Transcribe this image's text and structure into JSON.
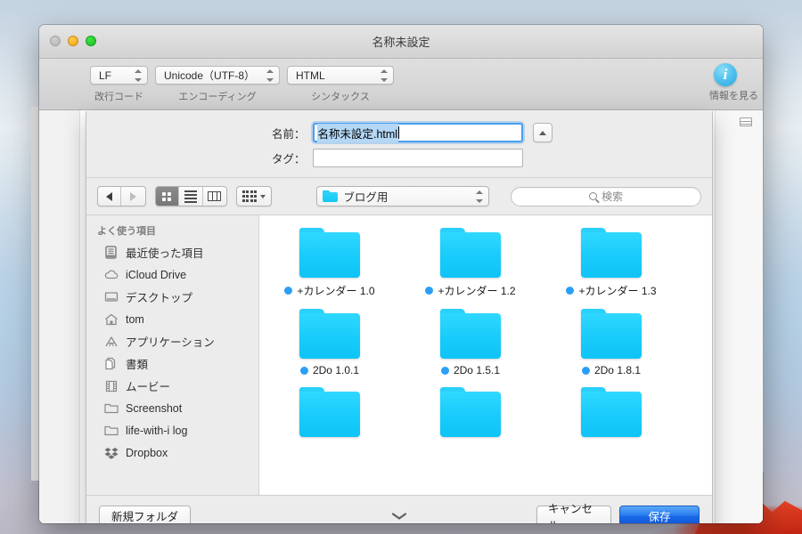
{
  "window": {
    "title": "名称未設定",
    "traffic_lights": [
      "close-button",
      "minimize-button",
      "zoom-button"
    ]
  },
  "doc_toolbar": {
    "popups": [
      {
        "name": "newline-code",
        "value": "LF",
        "label": "改行コード"
      },
      {
        "name": "encoding",
        "value": "Unicode（UTF-8）",
        "label": "エンコーディング"
      },
      {
        "name": "syntax",
        "value": "HTML",
        "label": "シンタックス"
      }
    ],
    "info": {
      "glyph": "i",
      "label": "情報を見る"
    }
  },
  "save_sheet": {
    "name_label": "名前：",
    "name_value": "名称未設定.html",
    "tag_label": "タグ：",
    "tag_value": "",
    "expand_icon": "chevron-up-icon"
  },
  "nav": {
    "back_icon": "chevron-left-icon",
    "forward_icon": "chevron-right-icon",
    "view_modes": [
      {
        "name": "icon-view",
        "icon": "grid-icon",
        "selected": true
      },
      {
        "name": "list-view",
        "icon": "list-icon",
        "selected": false
      },
      {
        "name": "column-view",
        "icon": "columns-icon",
        "selected": false
      }
    ],
    "arrange": {
      "name": "arrange-by",
      "icon": "arrange-icon"
    },
    "location": {
      "value": "ブログ用",
      "icon": "folder-icon"
    },
    "search": {
      "placeholder": "検索",
      "icon": "search-icon"
    }
  },
  "sidebar": {
    "header": "よく使う項目",
    "items": [
      {
        "label": "最近使った項目",
        "icon": "recents-icon"
      },
      {
        "label": "iCloud Drive",
        "icon": "cloud-icon"
      },
      {
        "label": "デスクトップ",
        "icon": "desktop-icon"
      },
      {
        "label": "tom",
        "icon": "home-icon"
      },
      {
        "label": "アプリケーション",
        "icon": "applications-icon"
      },
      {
        "label": "書類",
        "icon": "documents-icon"
      },
      {
        "label": "ムービー",
        "icon": "movies-icon"
      },
      {
        "label": "Screenshot",
        "icon": "folder-icon"
      },
      {
        "label": "life-with-i log",
        "icon": "folder-icon"
      },
      {
        "label": "Dropbox",
        "icon": "dropbox-icon"
      }
    ]
  },
  "filelist": {
    "rows": [
      [
        {
          "name": "+カレンダー 1.0",
          "tag_color": "#2b9ff5"
        },
        {
          "name": "+カレンダー 1.2",
          "tag_color": "#2b9ff5"
        },
        {
          "name": "+カレンダー 1.3",
          "tag_color": "#2b9ff5"
        }
      ],
      [
        {
          "name": "2Do 1.0.1",
          "tag_color": "#2b9ff5"
        },
        {
          "name": "2Do 1.5.1",
          "tag_color": "#2b9ff5"
        },
        {
          "name": "2Do 1.8.1",
          "tag_color": "#2b9ff5"
        }
      ],
      [
        {
          "name": "",
          "tag_color": "#2b9ff5"
        },
        {
          "name": "",
          "tag_color": "#2b9ff5"
        },
        {
          "name": "",
          "tag_color": "#2b9ff5"
        }
      ]
    ]
  },
  "sheet_bottom": {
    "new_folder": "新規フォルダ",
    "cancel": "キャンセル",
    "save": "保存",
    "disclose_icon": "chevron-down-icon"
  },
  "right_dock": {
    "items": [
      {
        "name": "dock-item-documents",
        "icon": "d-folder-icon"
      },
      {
        "name": "dock-item-display",
        "icon": "display-icon"
      },
      {
        "name": "dock-item-favorites",
        "icon": "heart-icon"
      },
      {
        "name": "dock-item-recent-folders",
        "icon": "folder-clock-icon"
      },
      {
        "name": "dock-item-recent-documents",
        "icon": "document-clock-icon"
      },
      {
        "name": "dock-item-finder",
        "icon": "finder-icon"
      }
    ]
  },
  "left_strip": {
    "items": [
      {
        "name": "add-shelf-item",
        "icon": "plus-dashed-icon"
      },
      {
        "name": "shelf-thumbnail",
        "icon": "image-thumbnail-icon"
      },
      {
        "name": "shelf-folder",
        "icon": "folder-icon"
      }
    ]
  },
  "colors": {
    "accent": "#1a6ae8",
    "folder": "#17cbfb",
    "tag_blue": "#2b9ff5",
    "selection": "#b3d7f5",
    "focus_ring": "#4a9ef0"
  }
}
